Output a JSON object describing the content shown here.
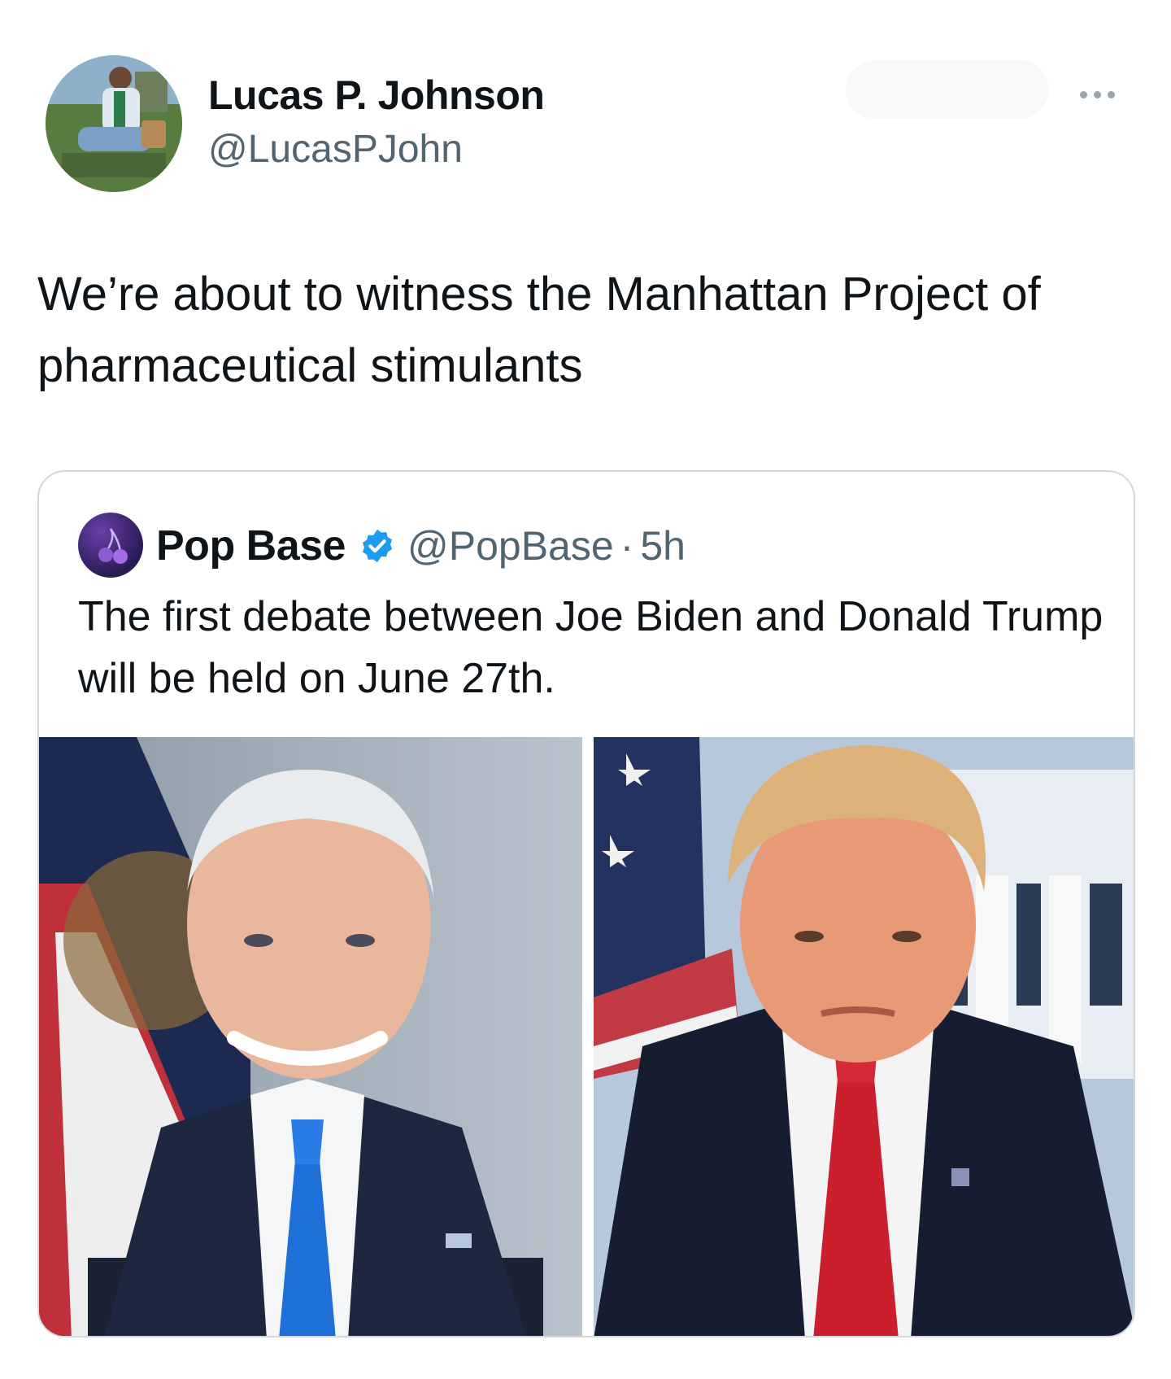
{
  "author": {
    "display_name": "Lucas P. Johnson",
    "handle": "@LucasPJohn",
    "avatar_icon": "profile-photo"
  },
  "tweet": {
    "text": "We’re about to witness the Manhattan Project of pharmaceutical stimulants"
  },
  "more_icon": "ellipsis-icon",
  "quoted_tweet": {
    "display_name": "Pop Base",
    "verified_icon": "verified-badge-icon",
    "handle": "@PopBase",
    "separator": "·",
    "time": "5h",
    "text": "The first debate between Joe Biden and Donald Trump will be held on June 27th.",
    "images": [
      "biden-portrait",
      "trump-portrait"
    ]
  },
  "colors": {
    "text_primary": "#0f1419",
    "text_secondary": "#536471",
    "border": "#cfd9de",
    "verified_blue": "#1d9bf0"
  }
}
